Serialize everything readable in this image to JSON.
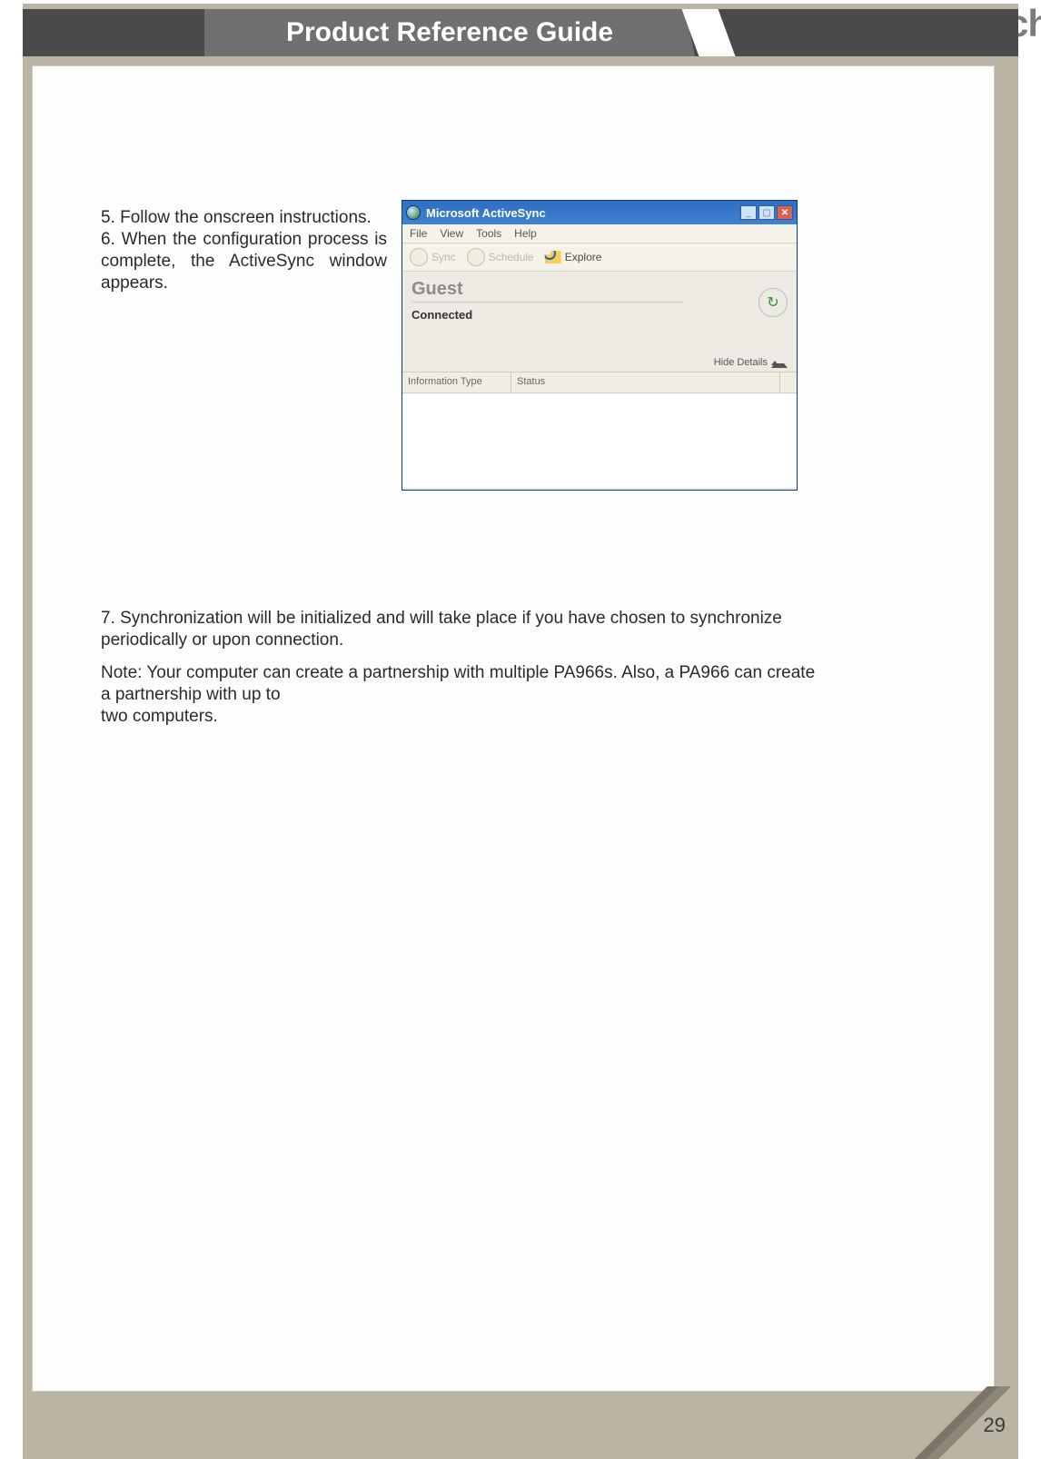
{
  "header": {
    "title": "Product Reference Guide",
    "brand": "unitech"
  },
  "steps": {
    "s5": "5. Follow the onscreen instructions.",
    "s6": "6. When the configuration process is complete, the ActiveSync window appears.",
    "s7": "7. Synchronization will be initialized and will take place if you have chosen to synchronize periodically or upon connection.",
    "note": "Note: Your computer can create a partnership with multiple PA966s. Also, a PA966 can create a partnership with up to",
    "note2": "two computers."
  },
  "activesync": {
    "title": "Microsoft ActiveSync",
    "menubar": [
      "File",
      "View",
      "Tools",
      "Help"
    ],
    "toolbar": {
      "sync": "Sync",
      "schedule": "Schedule",
      "explore": "Explore"
    },
    "guest": "Guest",
    "connected": "Connected",
    "hide_details": "Hide Details",
    "columns": {
      "info_type": "Information Type",
      "status": "Status"
    }
  },
  "page_number": "29"
}
